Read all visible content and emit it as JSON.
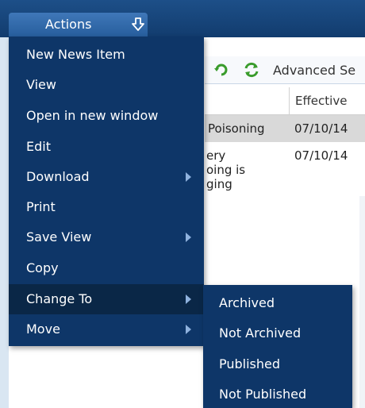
{
  "actions_button": {
    "label": "Actions",
    "icon": "arrow-down-icon"
  },
  "toolbar": {
    "icons": [
      "refresh-icon",
      "sync-icon"
    ],
    "advanced_search_label": "Advanced Se"
  },
  "grid": {
    "columns": [
      "",
      "Effective"
    ],
    "rows": [
      {
        "title_fragment": "Poisoning",
        "effective": "07/10/14"
      },
      {
        "title_lines": [
          "ery",
          "oing is",
          "ging"
        ],
        "effective": "07/10/14"
      }
    ]
  },
  "menu": {
    "items": [
      {
        "label": "New News Item",
        "has_submenu": false
      },
      {
        "label": "View",
        "has_submenu": false
      },
      {
        "label": "Open in new window",
        "has_submenu": false
      },
      {
        "label": "Edit",
        "has_submenu": false
      },
      {
        "label": "Download",
        "has_submenu": true
      },
      {
        "label": "Print",
        "has_submenu": false
      },
      {
        "label": "Save View",
        "has_submenu": true
      },
      {
        "label": "Copy",
        "has_submenu": false
      },
      {
        "label": "Change To",
        "has_submenu": true,
        "active": true
      },
      {
        "label": "Move",
        "has_submenu": true
      }
    ]
  },
  "submenu": {
    "items": [
      "Archived",
      "Not Archived",
      "Published",
      "Not Published"
    ]
  },
  "colors": {
    "menu_bg": "#0e3668",
    "menu_active_bg": "#0a2747",
    "topbar": "#123c6e",
    "button": "#3f77b8",
    "row_highlight": "#d9d9d9"
  }
}
